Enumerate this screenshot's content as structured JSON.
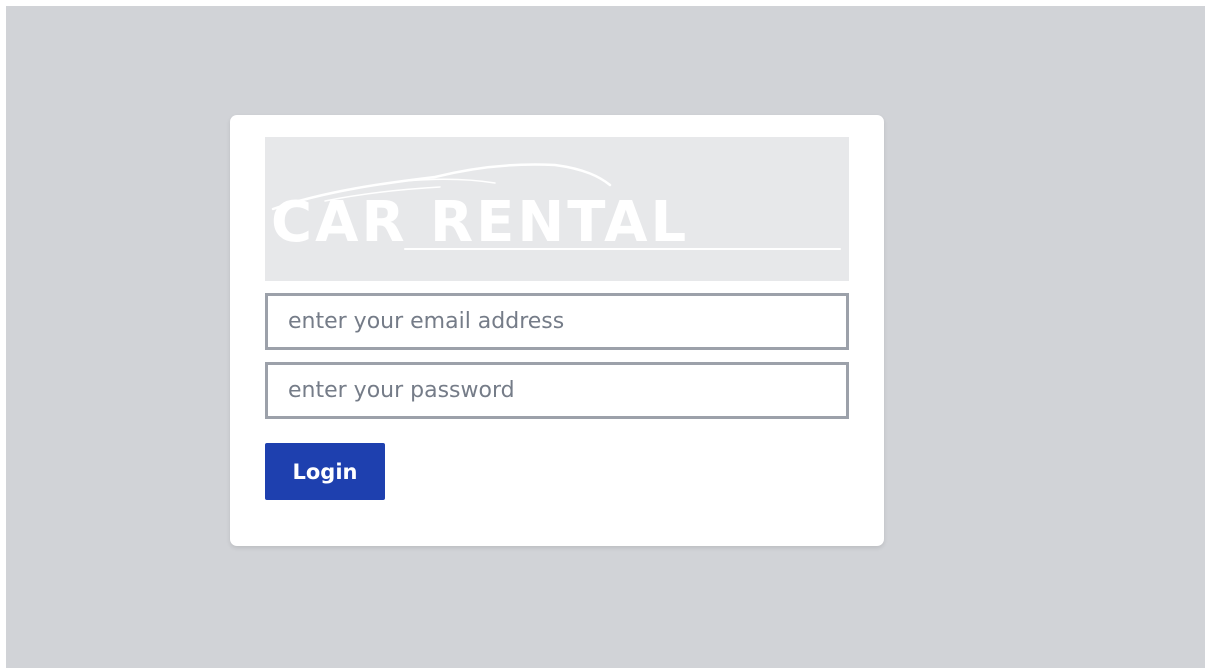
{
  "logo": {
    "text": "CAR RENTAL",
    "icon": "car-silhouette-icon",
    "background": "#e7e8ea",
    "color": "#ffffff"
  },
  "form": {
    "email_placeholder": "enter your email address",
    "email_value": "",
    "password_placeholder": "enter your password",
    "password_value": "",
    "login_label": "Login"
  },
  "colors": {
    "page_background": "#d1d3d7",
    "card_background": "#ffffff",
    "input_border": "#9ca1aa",
    "button_background": "#1e40af",
    "button_text": "#ffffff"
  }
}
